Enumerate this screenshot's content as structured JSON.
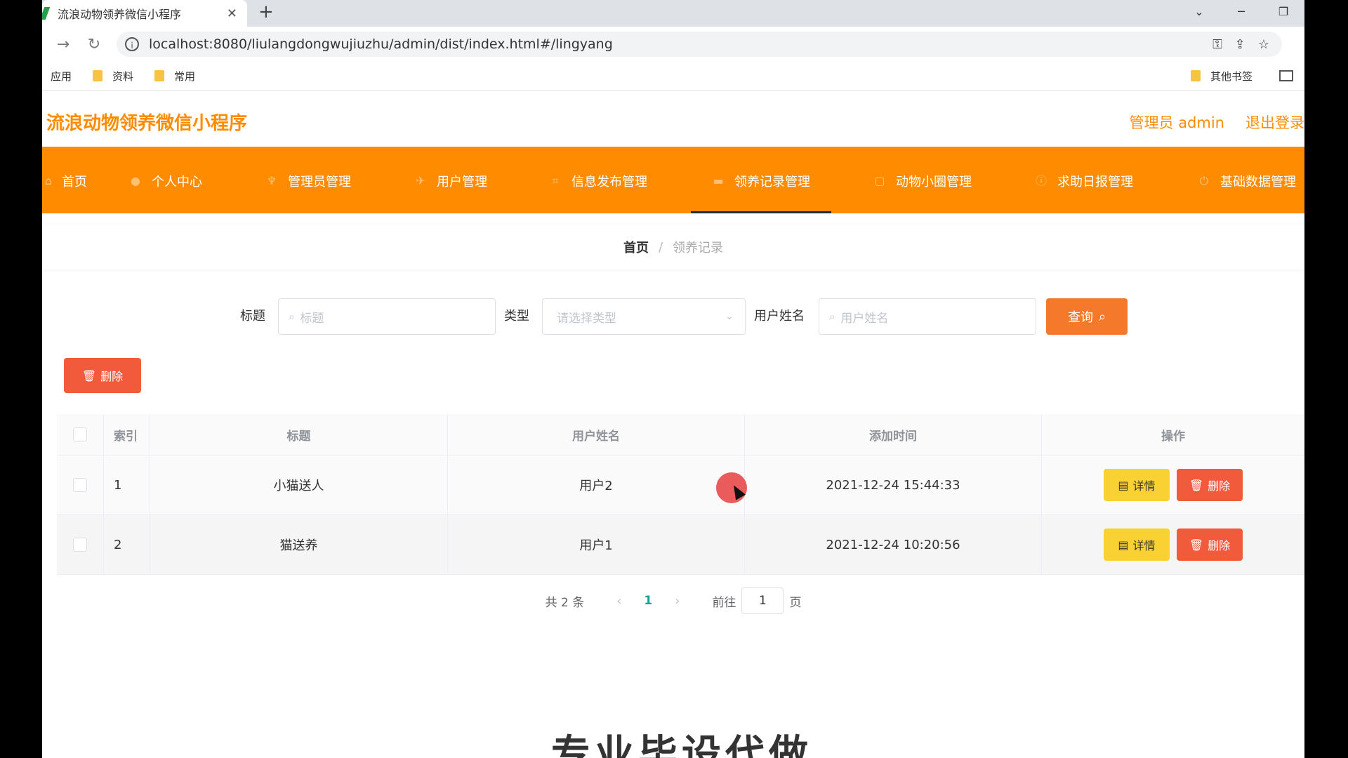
{
  "browser": {
    "tab_title": "流浪动物领养微信小程序",
    "url": "localhost:8080/liulangdongwujiuzhu/admin/dist/index.html#/lingyang",
    "bookmarks": [
      "应用",
      "资料",
      "常用"
    ],
    "other_bookmarks": "其他书签"
  },
  "header": {
    "app_title": "流浪动物领养微信小程序",
    "user_label": "管理员 admin",
    "logout_label": "退出登录"
  },
  "menu": {
    "items": [
      "首页",
      "个人中心",
      "管理员管理",
      "用户管理",
      "信息发布管理",
      "领养记录管理",
      "动物小圈管理",
      "求助日报管理",
      "基础数据管理"
    ]
  },
  "breadcrumb": {
    "home": "首页",
    "separator": "/",
    "current": "领养记录"
  },
  "search": {
    "title_label": "标题",
    "title_placeholder": "标题",
    "type_label": "类型",
    "type_placeholder": "请选择类型",
    "username_label": "用户姓名",
    "username_placeholder": "用户姓名",
    "query_button": "查询"
  },
  "actions": {
    "delete_label": "删除"
  },
  "table": {
    "columns": [
      "索引",
      "标题",
      "用户姓名",
      "添加时间",
      "操作"
    ],
    "rows": [
      {
        "index": "1",
        "title": "小猫送人",
        "user": "用户2",
        "time": "2021-12-24 15:44:33"
      },
      {
        "index": "2",
        "title": "猫送养",
        "user": "用户1",
        "time": "2021-12-24 10:20:56"
      }
    ],
    "detail_label": "详情",
    "delete_label": "删除"
  },
  "pagination": {
    "total": "共 2 条",
    "current_page": "1",
    "goto_label": "前往",
    "goto_value": "1",
    "page_suffix": "页"
  },
  "overlay": {
    "watermark": "专业毕设代做"
  },
  "colors": {
    "primary": "#ff8c00",
    "danger": "#f25a3c",
    "warning": "#fad132"
  }
}
